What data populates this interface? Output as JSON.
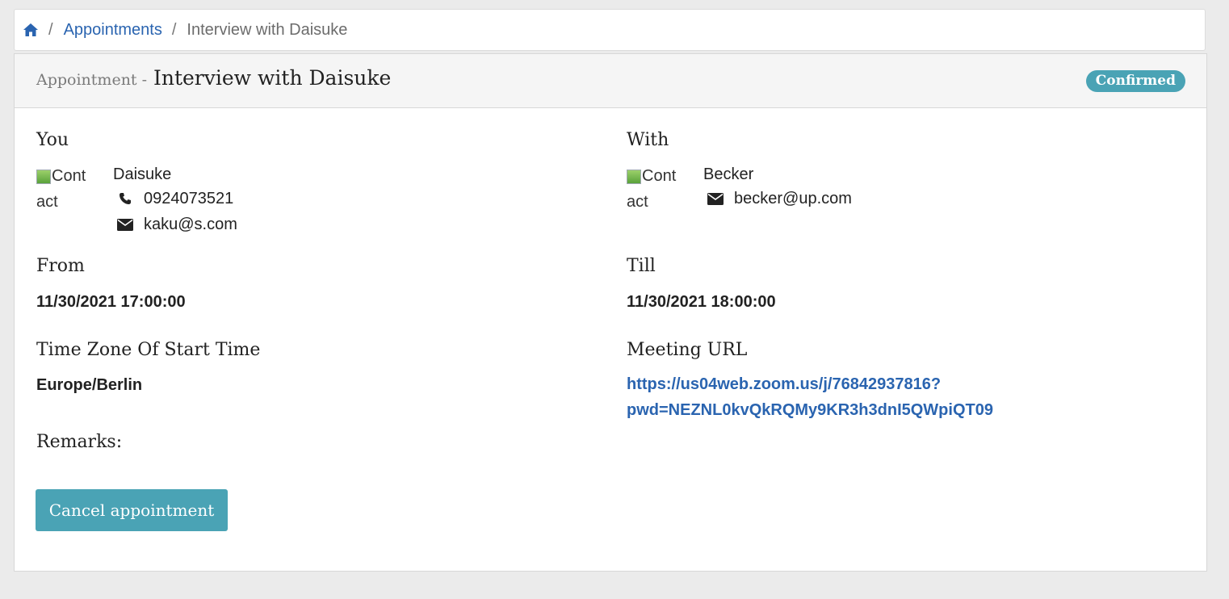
{
  "breadcrumb": {
    "home_icon": "home-icon",
    "separator": "/",
    "appointments_label": "Appointments",
    "current_label": "Interview with Daisuke"
  },
  "header": {
    "prefix": "Appointment -",
    "title": "Interview with Daisuke",
    "status": "Confirmed",
    "status_color": "#4aa3b5"
  },
  "you": {
    "label": "You",
    "image_alt": "Contact",
    "image_alt_line1": "Cont",
    "image_alt_line2": "act",
    "name": "Daisuke",
    "phone": "0924073521",
    "email": "kaku@s.com"
  },
  "with": {
    "label": "With",
    "image_alt": "Contact",
    "image_alt_line1": "Cont",
    "image_alt_line2": "act",
    "name": "Becker",
    "email": "becker@up.com"
  },
  "from": {
    "label": "From",
    "value": "11/30/2021 17:00:00"
  },
  "till": {
    "label": "Till",
    "value": "11/30/2021 18:00:00"
  },
  "timezone": {
    "label": "Time Zone Of Start Time",
    "value": "Europe/Berlin"
  },
  "meeting": {
    "label": "Meeting URL",
    "url_line1": "https://us04web.zoom.us/j/76842937816?",
    "url_line2": "pwd=NEZNL0kvQkRQMy9KR3h3dnI5QWpiQT09"
  },
  "remarks": {
    "label": "Remarks:"
  },
  "actions": {
    "cancel_label": "Cancel appointment"
  },
  "colors": {
    "link": "#2a64b0",
    "accent": "#4aa3b5"
  }
}
